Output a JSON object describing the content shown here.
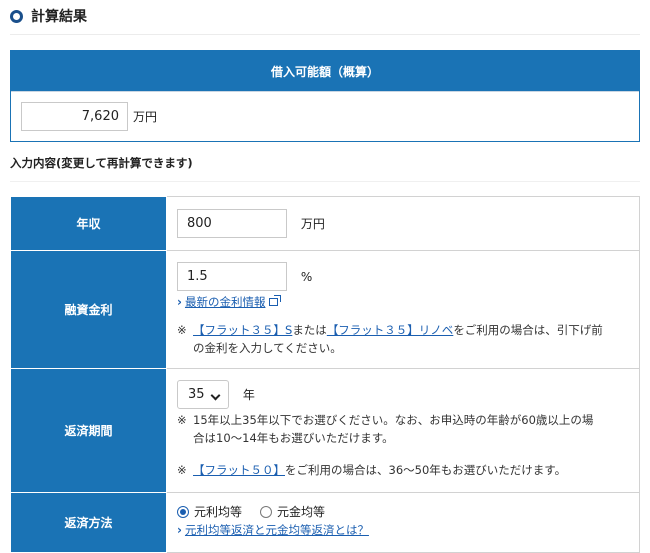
{
  "section": {
    "title": "計算結果"
  },
  "result": {
    "header": "借入可能額（概算）",
    "value": "7,620",
    "unit": "万円"
  },
  "inputs_title": "入力内容(変更して再計算できます)",
  "rows": {
    "income": {
      "label": "年収",
      "value": "800",
      "unit": "万円"
    },
    "rate": {
      "label": "融資金利",
      "value": "1.5",
      "unit": "%",
      "link": "最新の金利情報",
      "note_mark": "※",
      "note_link1": "【フラット３５】S",
      "note_mid": "または",
      "note_link2": "【フラット３５】リノベ",
      "note_after": "をご利用の場合は、引下げ前",
      "note_line2": "の金利を入力してください。"
    },
    "period": {
      "label": "返済期間",
      "selected": "35",
      "unit": "年",
      "note1_mark": "※",
      "note1_line1": "15年以上35年以下でお選びください。なお、お申込時の年齢が60歳以上の場",
      "note1_line2": "合は10～14年もお選びいただけます。",
      "note2_mark": "※",
      "note2_link": "【フラット５０】",
      "note2_after": "をご利用の場合は、36～50年もお選びいただけます。"
    },
    "method": {
      "label": "返済方法",
      "option1": "元利均等",
      "option2": "元金均等",
      "link": "元利均等返済と元金均等返済とは？"
    }
  },
  "colors": {
    "primary": "#1a73b5",
    "link": "#1a5eb0",
    "title_icon": "#1a4f8b"
  },
  "icons": {
    "title": "ring-icon",
    "link_arrow": "chevron-right-icon",
    "external": "external-link-icon",
    "select": "chevron-down-icon"
  }
}
